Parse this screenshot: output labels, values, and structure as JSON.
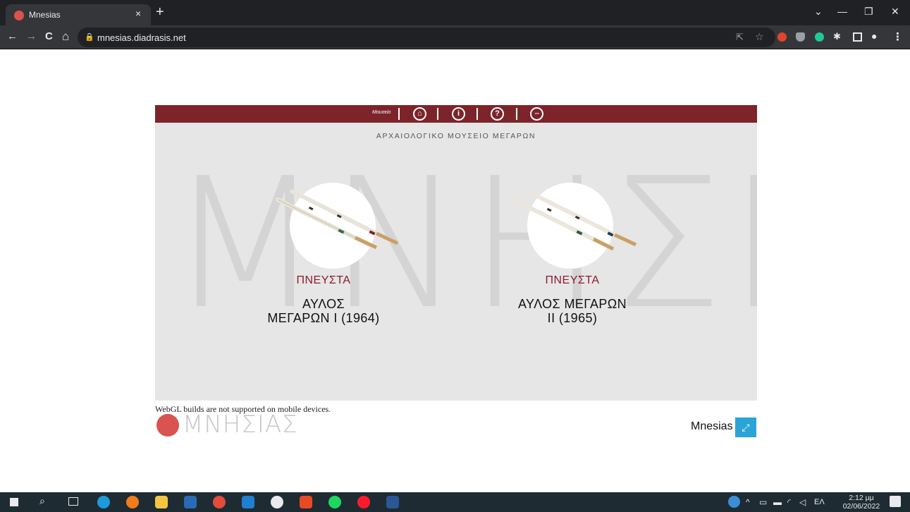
{
  "browser": {
    "tab_title": "Mnesias",
    "tab_close": "×",
    "new_tab": "+",
    "url": "mnesias.diadrasis.net",
    "nav": {
      "back": "←",
      "forward": "→",
      "reload": "C",
      "home": "⌂"
    },
    "window_controls": {
      "dropdown": "⌄",
      "minimize": "—",
      "maximize": "❐",
      "close": "✕"
    }
  },
  "unity": {
    "museum_label": "Μουσείο",
    "museum_title": "ΑΡΧΑΙΟΛΟΓΙΚΟ ΜΟΥΣΕΙΟ ΜΕΓΑΡΩΝ",
    "watermark": "ΜΝΗΣΙΑΣ",
    "items": [
      {
        "category": "ΠΝΕΥΣΤΑ",
        "name_line1": "ΑΥΛΟΣ",
        "name_line2": "ΜΕΓΑΡΩΝ I (1964)"
      },
      {
        "category": "ΠΝΕΥΣΤΑ",
        "name_line1": "ΑΥΛΟΣ ΜΕΓΑΡΩΝ",
        "name_line2": "II (1965)"
      }
    ]
  },
  "footer": {
    "webgl_message": "WebGL builds are not supported on mobile devices.",
    "logo_text": "ΜΝΗΣΙΑΣ",
    "app_name": "Mnesias"
  },
  "taskbar": {
    "language": "ΕΛ",
    "time": "2:12 μμ",
    "date": "02/06/2022"
  },
  "colors": {
    "brand": "#7d242b",
    "category": "#8c1c33",
    "fullscreen": "#2aa3d8"
  }
}
